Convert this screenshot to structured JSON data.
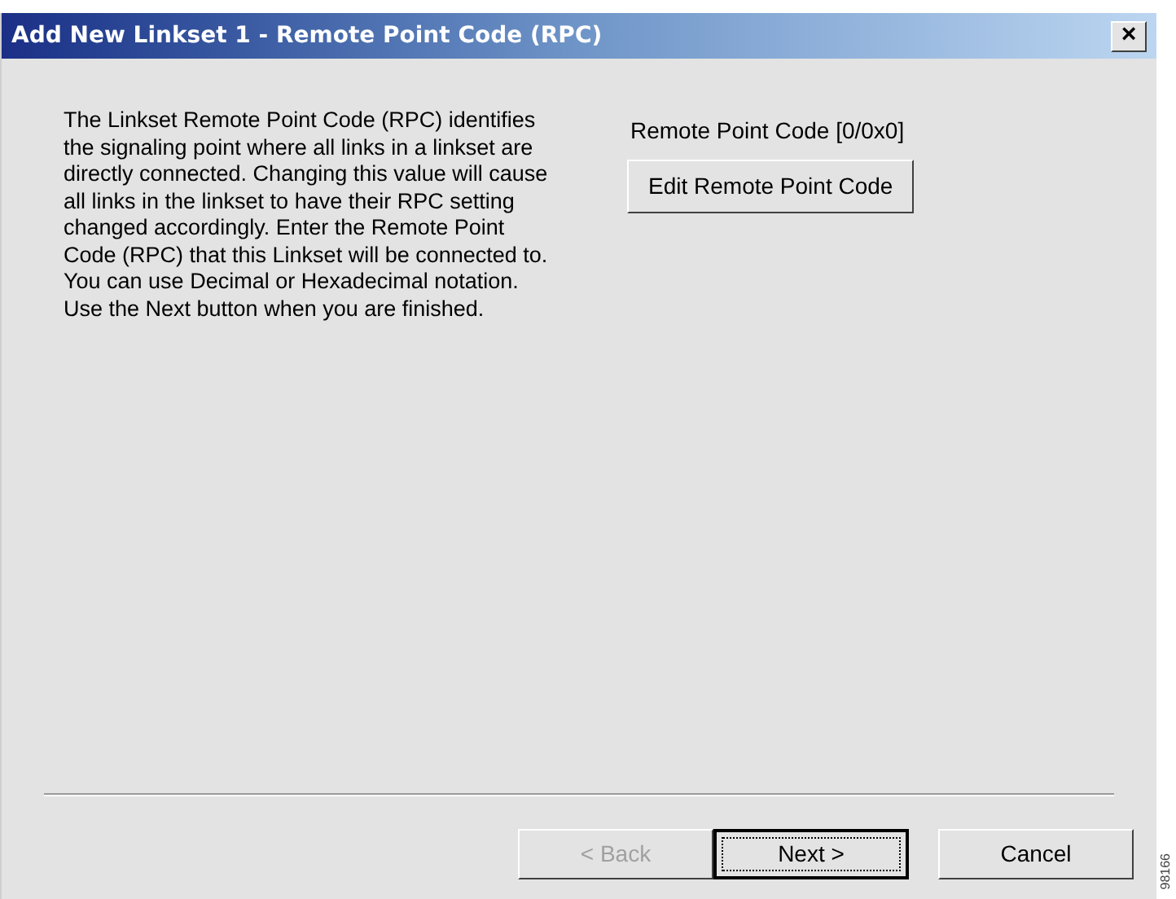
{
  "window": {
    "title": "Add New Linkset 1 - Remote Point Code (RPC)",
    "close": "×"
  },
  "description": "The Linkset Remote Point Code (RPC) identifies the signaling point where all links in a linkset are directly connected.  Changing this value will cause all links in the linkset to have their RPC setting changed accordingly.  Enter the Remote Point Code (RPC) that this Linkset will be connected to.  You can use Decimal or Hexadecimal notation.  Use the Next button when you are finished.",
  "rpc_label": "Remote Point Code [0/0x0]",
  "edit_button": "Edit Remote Point Code",
  "buttons": [
    {
      "label": "< Back",
      "disabled": true,
      "default": false
    },
    {
      "label": "Next >",
      "disabled": false,
      "default": true
    },
    {
      "label": "Cancel",
      "disabled": false,
      "default": false
    }
  ],
  "figure_id": "98166"
}
